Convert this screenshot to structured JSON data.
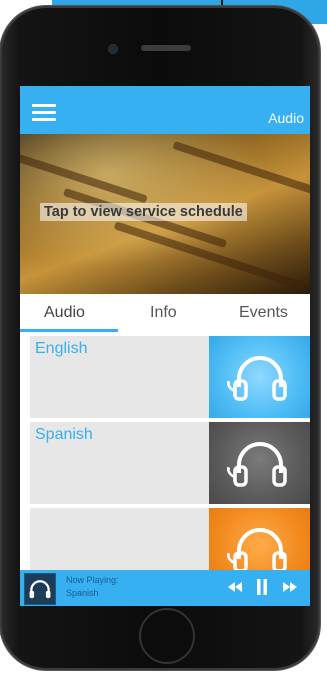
{
  "app": {
    "title": "Audio",
    "icons": {
      "menu": "hamburger-icon",
      "headphones": "headphones-icon",
      "prev": "rewind-icon",
      "pause": "pause-icon",
      "next": "fast-forward-icon"
    }
  },
  "hero": {
    "caption": "Tap to view service schedule",
    "slides_count": 4,
    "active_slide": 0
  },
  "tabs": [
    {
      "label": "Audio",
      "active": true
    },
    {
      "label": "Info",
      "active": false
    },
    {
      "label": "Events",
      "active": false
    }
  ],
  "channels": [
    {
      "label": "English",
      "color": "#4fbdf5"
    },
    {
      "label": "Spanish",
      "color": "#5a5a5a"
    },
    {
      "label": "",
      "color": "#f28a1e"
    }
  ],
  "player": {
    "now_playing_label": "Now Playing:",
    "track": "Spanish"
  },
  "colors": {
    "accent": "#36b0f0",
    "row_bg": "#e7e7e7"
  }
}
